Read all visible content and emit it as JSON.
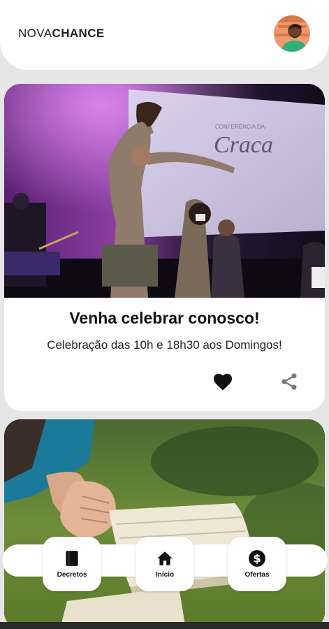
{
  "header": {
    "logo_light": "NOVA",
    "logo_bold": "CHANCE"
  },
  "cards": [
    {
      "title": "Venha celebrar conosco!",
      "subtitle": "Celebração das 10h e 18h30 aos Domingos!",
      "image_text": "Craca",
      "image_small_text": "CONFERÊNCIA DA"
    },
    {
      "title": "",
      "subtitle": ""
    }
  ],
  "nav": {
    "items": [
      {
        "label": "Decretos",
        "icon": "book-icon"
      },
      {
        "label": "Início",
        "icon": "home-icon"
      },
      {
        "label": "Ofertas",
        "icon": "dollar-icon"
      }
    ]
  },
  "colors": {
    "background": "#e6e6e6",
    "card": "#ffffff",
    "text": "#111111"
  }
}
